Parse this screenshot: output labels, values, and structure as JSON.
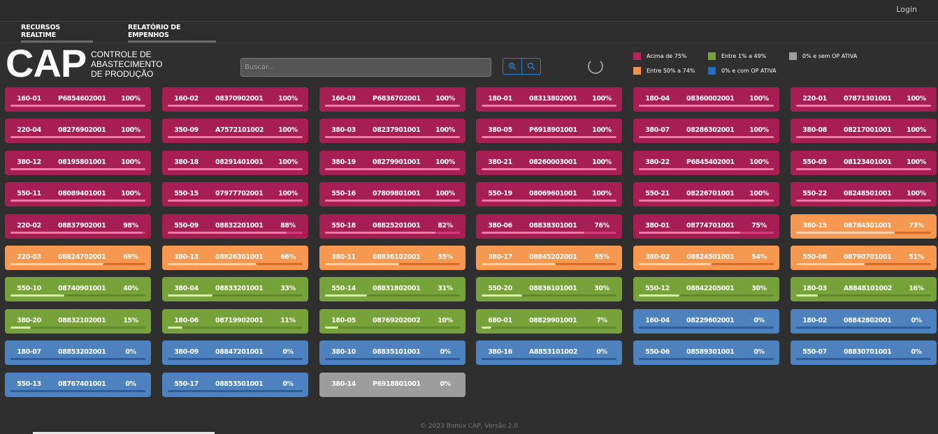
{
  "header": {
    "login_label": "Login"
  },
  "tabs": [
    {
      "label": "RECURSOS REALTIME"
    },
    {
      "label": "RELATÓRIO DE EMPENHOS"
    }
  ],
  "brand": {
    "logo": "CAP",
    "subtitle": "CONTROLE DE ABASTECIMENTO DE PRODUÇÃO"
  },
  "search": {
    "placeholder": "Buscar...",
    "value": ""
  },
  "toolbar": {
    "zoom_icon": "zoom-in-icon",
    "search_icon": "search-icon"
  },
  "legend": [
    {
      "label": "Acima de 75%",
      "color": "#b3245c"
    },
    {
      "label": "Entre 50% a 74%",
      "color": "#f4924f"
    },
    {
      "label": "Entre 1% a 49%",
      "color": "#76a339"
    },
    {
      "label": "0% e com OP ATIVA",
      "color": "#1f6fc2"
    },
    {
      "label": "0% e sem OP ATIVA",
      "color": "#9e9e9e"
    }
  ],
  "palette": {
    "high": {
      "bg": "#a71f52",
      "track": "#d43d7a",
      "fill": "#f07aa8"
    },
    "mid": {
      "bg": "#f6984f",
      "track": "#d96a29",
      "fill": "#fcd0ad"
    },
    "low": {
      "bg": "#76a339",
      "track": "#5c8a2c",
      "fill": "#d7f0a8"
    },
    "zero": {
      "bg": "#4d82bf",
      "track": "#2f5c9a",
      "fill": "#2f5c9a"
    },
    "inactive": {
      "bg": "#9d9d9d",
      "track": "#9d9d9d",
      "fill": "#9d9d9d"
    }
  },
  "resources": [
    {
      "res": "160-01",
      "op": "P6854602001",
      "pct": "100%",
      "level": 100,
      "status": "high"
    },
    {
      "res": "160-02",
      "op": "08370902001",
      "pct": "100%",
      "level": 100,
      "status": "high"
    },
    {
      "res": "160-03",
      "op": "P6836702001",
      "pct": "100%",
      "level": 100,
      "status": "high"
    },
    {
      "res": "180-01",
      "op": "08313802001",
      "pct": "100%",
      "level": 100,
      "status": "high"
    },
    {
      "res": "180-04",
      "op": "08360002001",
      "pct": "100%",
      "level": 100,
      "status": "high"
    },
    {
      "res": "220-01",
      "op": "07871301001",
      "pct": "100%",
      "level": 100,
      "status": "high"
    },
    {
      "res": "220-04",
      "op": "08276902001",
      "pct": "100%",
      "level": 100,
      "status": "high"
    },
    {
      "res": "350-09",
      "op": "A7572101002",
      "pct": "100%",
      "level": 100,
      "status": "high"
    },
    {
      "res": "380-03",
      "op": "08237901001",
      "pct": "100%",
      "level": 100,
      "status": "high"
    },
    {
      "res": "380-05",
      "op": "P6918901001",
      "pct": "100%",
      "level": 100,
      "status": "high"
    },
    {
      "res": "380-07",
      "op": "08286302001",
      "pct": "100%",
      "level": 100,
      "status": "high"
    },
    {
      "res": "380-08",
      "op": "08217001001",
      "pct": "100%",
      "level": 100,
      "status": "high"
    },
    {
      "res": "380-12",
      "op": "08195801001",
      "pct": "100%",
      "level": 100,
      "status": "high"
    },
    {
      "res": "380-18",
      "op": "08291401001",
      "pct": "100%",
      "level": 100,
      "status": "high"
    },
    {
      "res": "380-19",
      "op": "08279901001",
      "pct": "100%",
      "level": 100,
      "status": "high"
    },
    {
      "res": "380-21",
      "op": "08260003001",
      "pct": "100%",
      "level": 100,
      "status": "high"
    },
    {
      "res": "380-22",
      "op": "P6845402001",
      "pct": "100%",
      "level": 100,
      "status": "high"
    },
    {
      "res": "550-05",
      "op": "08123401001",
      "pct": "100%",
      "level": 100,
      "status": "high"
    },
    {
      "res": "550-11",
      "op": "08089401001",
      "pct": "100%",
      "level": 100,
      "status": "high"
    },
    {
      "res": "550-15",
      "op": "07977702001",
      "pct": "100%",
      "level": 100,
      "status": "high"
    },
    {
      "res": "550-16",
      "op": "07809801001",
      "pct": "100%",
      "level": 100,
      "status": "high"
    },
    {
      "res": "550-19",
      "op": "08069601001",
      "pct": "100%",
      "level": 100,
      "status": "high"
    },
    {
      "res": "550-21",
      "op": "08226701001",
      "pct": "100%",
      "level": 100,
      "status": "high"
    },
    {
      "res": "550-22",
      "op": "08248501001",
      "pct": "100%",
      "level": 100,
      "status": "high"
    },
    {
      "res": "220-02",
      "op": "08837902001",
      "pct": "98%",
      "level": 98,
      "status": "high"
    },
    {
      "res": "550-09",
      "op": "08832201001",
      "pct": "88%",
      "level": 88,
      "status": "high"
    },
    {
      "res": "550-18",
      "op": "08825201001",
      "pct": "82%",
      "level": 82,
      "status": "high"
    },
    {
      "res": "380-06",
      "op": "08838301001",
      "pct": "76%",
      "level": 76,
      "status": "high"
    },
    {
      "res": "380-01",
      "op": "08774701001",
      "pct": "75%",
      "level": 75,
      "status": "high"
    },
    {
      "res": "380-15",
      "op": "08784301001",
      "pct": "73%",
      "level": 73,
      "status": "mid"
    },
    {
      "res": "220-03",
      "op": "08824702001",
      "pct": "69%",
      "level": 69,
      "status": "mid"
    },
    {
      "res": "380-13",
      "op": "08826301001",
      "pct": "66%",
      "level": 66,
      "status": "mid"
    },
    {
      "res": "380-11",
      "op": "08836102001",
      "pct": "55%",
      "level": 55,
      "status": "mid"
    },
    {
      "res": "380-17",
      "op": "08845202001",
      "pct": "55%",
      "level": 55,
      "status": "mid"
    },
    {
      "res": "380-02",
      "op": "08824501001",
      "pct": "54%",
      "level": 54,
      "status": "mid"
    },
    {
      "res": "550-08",
      "op": "08790701001",
      "pct": "51%",
      "level": 51,
      "status": "mid"
    },
    {
      "res": "550-10",
      "op": "08740901001",
      "pct": "40%",
      "level": 40,
      "status": "low"
    },
    {
      "res": "380-04",
      "op": "08833201001",
      "pct": "33%",
      "level": 33,
      "status": "low"
    },
    {
      "res": "550-14",
      "op": "08831802001",
      "pct": "31%",
      "level": 31,
      "status": "low"
    },
    {
      "res": "550-20",
      "op": "08836101001",
      "pct": "30%",
      "level": 30,
      "status": "low"
    },
    {
      "res": "550-12",
      "op": "08842205001",
      "pct": "30%",
      "level": 30,
      "status": "low"
    },
    {
      "res": "180-03",
      "op": "A8848101002",
      "pct": "16%",
      "level": 16,
      "status": "low"
    },
    {
      "res": "380-20",
      "op": "08832102001",
      "pct": "15%",
      "level": 15,
      "status": "low"
    },
    {
      "res": "180-06",
      "op": "08719902001",
      "pct": "11%",
      "level": 11,
      "status": "low"
    },
    {
      "res": "180-05",
      "op": "08769202002",
      "pct": "10%",
      "level": 10,
      "status": "low"
    },
    {
      "res": "680-01",
      "op": "08829901001",
      "pct": "7%",
      "level": 7,
      "status": "low"
    },
    {
      "res": "160-04",
      "op": "08229602001",
      "pct": "0%",
      "level": 0,
      "status": "zero"
    },
    {
      "res": "180-02",
      "op": "08842802001",
      "pct": "0%",
      "level": 0,
      "status": "zero"
    },
    {
      "res": "180-07",
      "op": "08853202001",
      "pct": "0%",
      "level": 0,
      "status": "zero"
    },
    {
      "res": "380-09",
      "op": "08847201001",
      "pct": "0%",
      "level": 0,
      "status": "zero"
    },
    {
      "res": "380-10",
      "op": "08835101001",
      "pct": "0%",
      "level": 0,
      "status": "zero"
    },
    {
      "res": "380-16",
      "op": "A8853101002",
      "pct": "0%",
      "level": 0,
      "status": "zero"
    },
    {
      "res": "550-06",
      "op": "08589301001",
      "pct": "0%",
      "level": 0,
      "status": "zero"
    },
    {
      "res": "550-07",
      "op": "08830701001",
      "pct": "0%",
      "level": 0,
      "status": "zero"
    },
    {
      "res": "550-13",
      "op": "08767401001",
      "pct": "0%",
      "level": 0,
      "status": "zero"
    },
    {
      "res": "550-17",
      "op": "08853501001",
      "pct": "0%",
      "level": 0,
      "status": "zero"
    },
    {
      "res": "380-14",
      "op": "P6918801001",
      "pct": "0%",
      "level": 0,
      "status": "inactive"
    }
  ],
  "footer": {
    "text": "© 2023 Bomix CAP, Versão 2.0"
  }
}
